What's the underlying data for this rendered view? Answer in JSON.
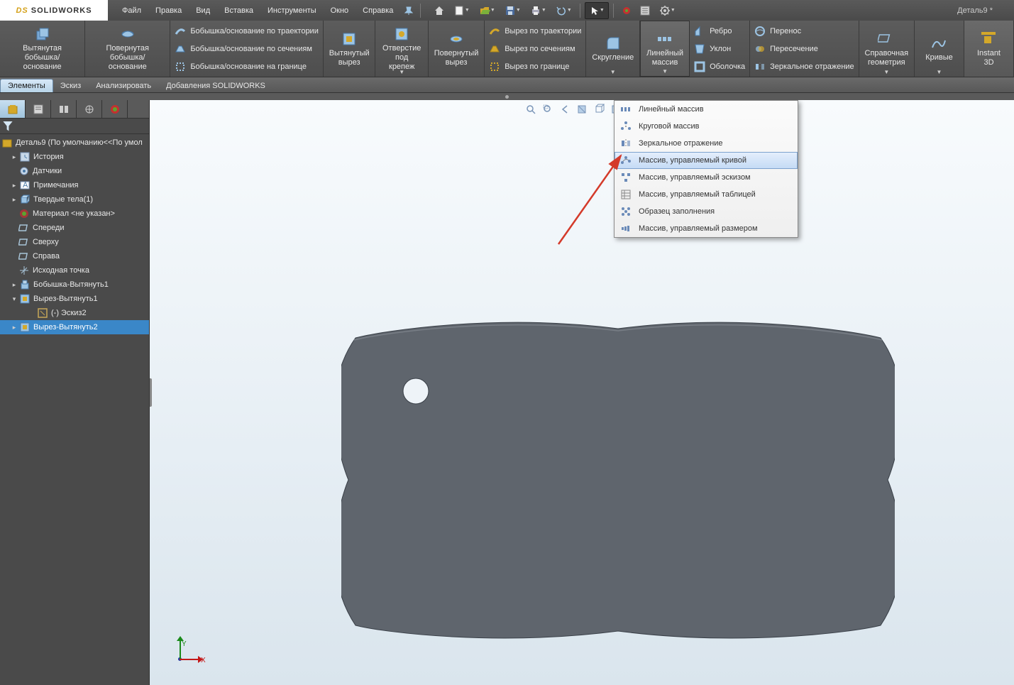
{
  "app": {
    "title": "Деталь9 *",
    "logo": "SOLIDWORKS"
  },
  "menubar": [
    "Файл",
    "Правка",
    "Вид",
    "Вставка",
    "Инструменты",
    "Окно",
    "Справка"
  ],
  "ribbon": {
    "extruded_boss": "Вытянутая\nбобышка/основание",
    "revolved_boss": "Повернутая\nбобышка/основание",
    "swept_boss": "Бобышка/основание по траектории",
    "lofted_boss": "Бобышка/основание по сечениям",
    "boundary_boss": "Бобышка/основание на границе",
    "extruded_cut": "Вытянутый\nвырез",
    "hole_wizard": "Отверстие\nпод крепеж",
    "revolved_cut": "Повернутый\nвырез",
    "swept_cut": "Вырез по траектории",
    "lofted_cut": "Вырез по сечениям",
    "boundary_cut": "Вырез по границе",
    "fillet": "Скругление",
    "linear_pattern": "Линейный\nмассив",
    "rib": "Ребро",
    "draft": "Уклон",
    "shell": "Оболочка",
    "wrap": "Перенос",
    "intersect": "Пересечение",
    "mirror": "Зеркальное отражение",
    "ref_geom": "Справочная\nгеометрия",
    "curves": "Кривые",
    "instant3d": "Instant\n3D"
  },
  "command_tabs": [
    "Элементы",
    "Эскиз",
    "Анализировать",
    "Добавления SOLIDWORKS"
  ],
  "tree": {
    "root": "Деталь9  (По умолчанию<<По умол",
    "items": [
      {
        "label": "История",
        "icon": "history",
        "expandable": true
      },
      {
        "label": "Датчики",
        "icon": "sensor",
        "expandable": false
      },
      {
        "label": "Примечания",
        "icon": "annotation",
        "expandable": true
      },
      {
        "label": "Твердые тела(1)",
        "icon": "solid",
        "expandable": true
      },
      {
        "label": "Материал <не указан>",
        "icon": "material",
        "expandable": false
      },
      {
        "label": "Спереди",
        "icon": "plane",
        "expandable": false
      },
      {
        "label": "Сверху",
        "icon": "plane",
        "expandable": false
      },
      {
        "label": "Справа",
        "icon": "plane",
        "expandable": false
      },
      {
        "label": "Исходная точка",
        "icon": "origin",
        "expandable": false
      },
      {
        "label": "Бобышка-Вытянуть1",
        "icon": "feature",
        "expandable": true
      },
      {
        "label": "Вырез-Вытянуть1",
        "icon": "cut",
        "expandable": true,
        "expanded": true
      },
      {
        "label": "(-) Эскиз2",
        "icon": "sketch",
        "child": true
      },
      {
        "label": "Вырез-Вытянуть2",
        "icon": "cut",
        "expandable": true,
        "selected": true
      }
    ]
  },
  "dropdown": {
    "items": [
      "Линейный массив",
      "Круговой массив",
      "Зеркальное отражение",
      "Массив, управляемый кривой",
      "Массив, управляемый эскизом",
      "Массив, управляемый таблицей",
      "Образец заполнения",
      "Массив, управляемый размером"
    ],
    "hovered_index": 3
  },
  "axis": {
    "x": "X",
    "y": "Y"
  }
}
